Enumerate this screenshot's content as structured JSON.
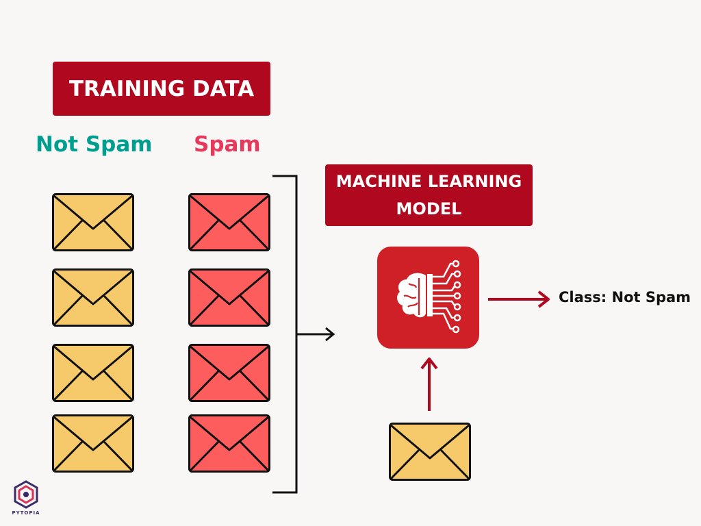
{
  "colors": {
    "badge_bg": "#b0081e",
    "not_spam_text": "#009e8f",
    "spam_text": "#e53a5c",
    "not_spam_envelope": "#f6c96b",
    "spam_envelope": "#fe5d5d",
    "arrow_red": "#b0081e",
    "arrow_black": "#000000",
    "model_icon_bg": "#cf2027"
  },
  "training_badge": {
    "label": "TRAINING DATA"
  },
  "columns": {
    "not_spam": {
      "label": "Not Spam",
      "count": 4
    },
    "spam": {
      "label": "Spam",
      "count": 4
    }
  },
  "model_badge": {
    "line1": "MACHINE LEARNING",
    "line2": "MODEL"
  },
  "model_icon": {
    "icon": "brain-circuit-icon"
  },
  "output": {
    "label": "Class: Not Spam"
  },
  "input_email": {
    "icon": "envelope-icon"
  },
  "logo": {
    "label": "PYTOPIA"
  }
}
